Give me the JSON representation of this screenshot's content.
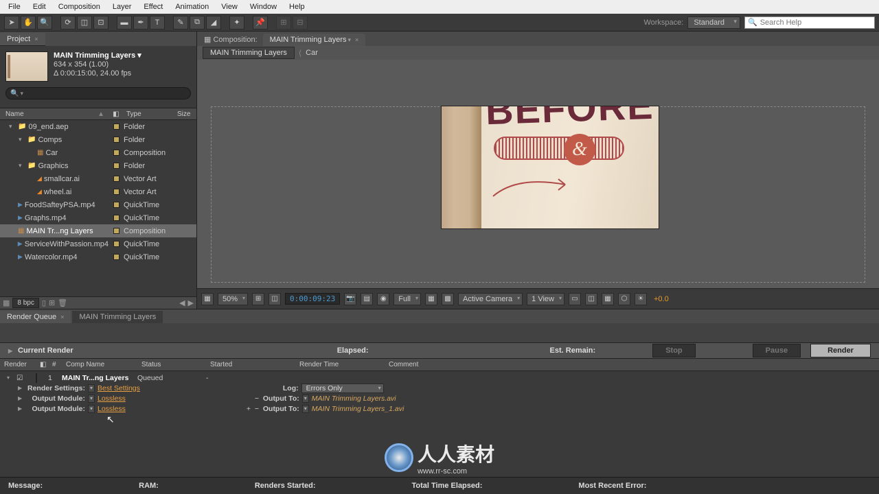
{
  "menu": [
    "File",
    "Edit",
    "Composition",
    "Layer",
    "Effect",
    "Animation",
    "View",
    "Window",
    "Help"
  ],
  "workspace": {
    "label": "Workspace:",
    "value": "Standard"
  },
  "search": {
    "placeholder": "Search Help"
  },
  "project": {
    "tab": "Project",
    "comp_name": "MAIN Trimming Layers ▾",
    "dims": "634 x 354 (1.00)",
    "duration": "Δ 0:00:15:00, 24.00 fps",
    "cols": {
      "name": "Name",
      "type": "Type",
      "size": "Size"
    },
    "items": [
      {
        "indent": 0,
        "tw": "▾",
        "icon": "folder",
        "name": "09_end.aep",
        "type": "Folder"
      },
      {
        "indent": 1,
        "tw": "▾",
        "icon": "folder",
        "name": "Comps",
        "type": "Folder"
      },
      {
        "indent": 2,
        "tw": "",
        "icon": "comp",
        "name": "Car",
        "type": "Composition"
      },
      {
        "indent": 1,
        "tw": "▾",
        "icon": "folder",
        "name": "Graphics",
        "type": "Folder"
      },
      {
        "indent": 2,
        "tw": "",
        "icon": "ai",
        "name": "smallcar.ai",
        "type": "Vector Art"
      },
      {
        "indent": 2,
        "tw": "",
        "icon": "ai",
        "name": "wheel.ai",
        "type": "Vector Art"
      },
      {
        "indent": 0,
        "tw": "",
        "icon": "mov",
        "name": "FoodSafteyPSA.mp4",
        "type": "QuickTime"
      },
      {
        "indent": 0,
        "tw": "",
        "icon": "mov",
        "name": "Graphs.mp4",
        "type": "QuickTime"
      },
      {
        "indent": 0,
        "tw": "",
        "icon": "comp",
        "name": "MAIN Tr...ng Layers",
        "type": "Composition",
        "sel": true
      },
      {
        "indent": 0,
        "tw": "",
        "icon": "mov",
        "name": "ServiceWithPassion.mp4",
        "type": "QuickTime"
      },
      {
        "indent": 0,
        "tw": "",
        "icon": "mov",
        "name": "Watercolor.mp4",
        "type": "QuickTime"
      }
    ],
    "footer_bpc": "8 bpc"
  },
  "viewer": {
    "prefix": "Composition:",
    "tab": "MAIN Trimming Layers",
    "bc1": "MAIN Trimming Layers",
    "bc2": "Car",
    "canvas_text": "BEFORE",
    "amp": "&",
    "footer": {
      "zoom": "50%",
      "timecode": "0:00:09:23",
      "res": "Full",
      "camera": "Active Camera",
      "view": "1 View",
      "exposure": "+0.0"
    }
  },
  "render_queue": {
    "tab1": "Render Queue",
    "tab2": "MAIN Trimming Layers",
    "current": "Current Render",
    "elapsed": "Elapsed:",
    "remain": "Est. Remain:",
    "btn_stop": "Stop",
    "btn_pause": "Pause",
    "btn_render": "Render",
    "cols": {
      "render": "Render",
      "num": "#",
      "comp": "Comp Name",
      "status": "Status",
      "started": "Started",
      "rtime": "Render Time",
      "comment": "Comment"
    },
    "row": {
      "num": "1",
      "name": "MAIN Tr...ng Layers",
      "status": "Queued",
      "started": "-"
    },
    "settings": {
      "rs_label": "Render Settings:",
      "rs_val": "Best Settings",
      "om_label": "Output Module:",
      "om_val": "Lossless",
      "log_label": "Log:",
      "log_val": "Errors Only",
      "ot_label": "Output To:",
      "ot_val1": "MAIN Trimming Layers.avi",
      "ot_val2": "MAIN Trimming Layers_1.avi"
    }
  },
  "statusbar": {
    "msg": "Message:",
    "ram": "RAM:",
    "renders": "Renders Started:",
    "total": "Total Time Elapsed:",
    "recent": "Most Recent Error:"
  },
  "watermark": "人人素材",
  "watermark_url": "www.rr-sc.com"
}
